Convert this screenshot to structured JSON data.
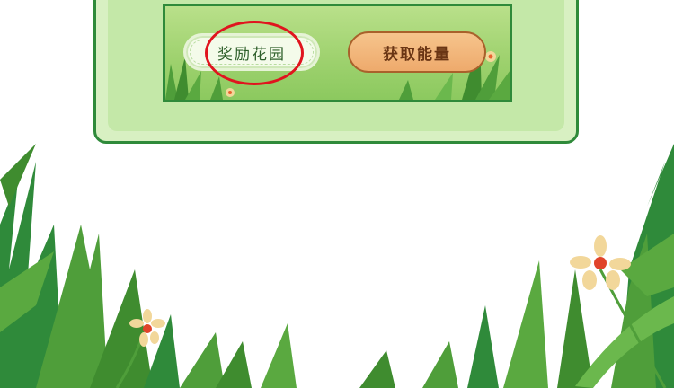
{
  "buttons": {
    "reward_garden_label": "奖励花园",
    "get_energy_label": "获取能量"
  },
  "colors": {
    "frame_border": "#2f8a3a",
    "frame_fill": "#d8f0c2",
    "banner_green": "#9fd26f",
    "energy_button": "#eeaa6c",
    "highlight_ring": "#e0141e"
  },
  "icons": [
    "flower-icon",
    "grass-decoration"
  ]
}
